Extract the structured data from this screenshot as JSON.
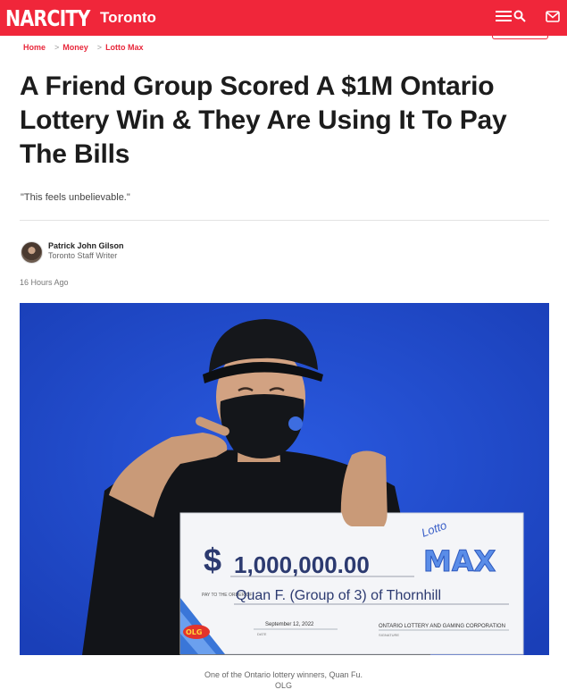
{
  "header": {
    "logo": "NARCITY",
    "city": "Toronto",
    "brand_color": "#f0263a",
    "icons": [
      "menu-icon",
      "search-icon",
      "mail-icon"
    ]
  },
  "breadcrumb": [
    {
      "label": "Home"
    },
    {
      "label": "Money"
    },
    {
      "label": "Lotto Max"
    }
  ],
  "article": {
    "title": "A Friend Group Scored A $1M Ontario Lottery Win & They Are Using It To Pay The Bills",
    "dek": "\"This feels unbelievable.\"",
    "author": {
      "name": "Patrick John Gilson",
      "role": "Toronto Staff Writer"
    },
    "timestamp": "16 Hours Ago",
    "image": {
      "cheque": {
        "brand_top": "Lotto",
        "brand_main": "MAX",
        "amount_symbol": "$",
        "amount": "1,000,000.00",
        "pay_to_label": "PAY TO THE ORDER OF",
        "payee": "Quan F. (Group of 3) of Thornhill",
        "date": "September 12, 2022",
        "date_label": "DATE",
        "issuer": "ONTARIO LOTTERY AND GAMING CORPORATION",
        "signature_label": "SIGNATURE",
        "olg": "OLG"
      }
    },
    "caption": {
      "text": "One of the Ontario lottery winners, Quan Fu.",
      "credit": "OLG"
    }
  }
}
